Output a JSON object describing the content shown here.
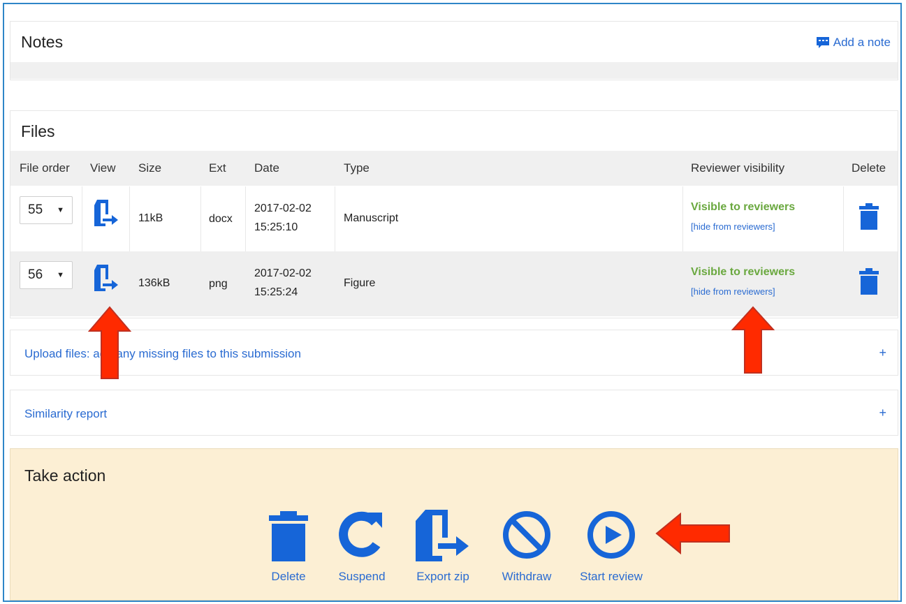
{
  "notes": {
    "title": "Notes",
    "add_note": "Add a note"
  },
  "files": {
    "title": "Files",
    "columns": {
      "order": "File order",
      "view": "View",
      "size": "Size",
      "ext": "Ext",
      "date": "Date",
      "type": "Type",
      "visibility": "Reviewer visibility",
      "delete": "Delete"
    },
    "rows": [
      {
        "order": "55",
        "size": "11kB",
        "ext": "docx",
        "date": "2017-02-02",
        "time": "15:25:10",
        "type": "Manuscript",
        "visibility": "Visible to reviewers",
        "hide": "[hide from reviewers]"
      },
      {
        "order": "56",
        "size": "136kB",
        "ext": "png",
        "date": "2017-02-02",
        "time": "15:25:24",
        "type": "Figure",
        "visibility": "Visible to reviewers",
        "hide": "[hide from reviewers]"
      }
    ]
  },
  "upload": {
    "label": "Upload files: add any missing files to this submission",
    "toggle": "+"
  },
  "similarity": {
    "label": "Similarity report",
    "toggle": "+"
  },
  "action": {
    "title": "Take action",
    "buttons": {
      "delete": "Delete",
      "suspend": "Suspend",
      "export": "Export zip",
      "withdraw": "Withdraw",
      "start": "Start review"
    }
  },
  "colors": {
    "accent": "#1665d8",
    "link": "#2a6bd1",
    "visible_green": "#6aa83f",
    "action_bg": "#fcefd4",
    "arrow_red": "#ff2a00"
  }
}
